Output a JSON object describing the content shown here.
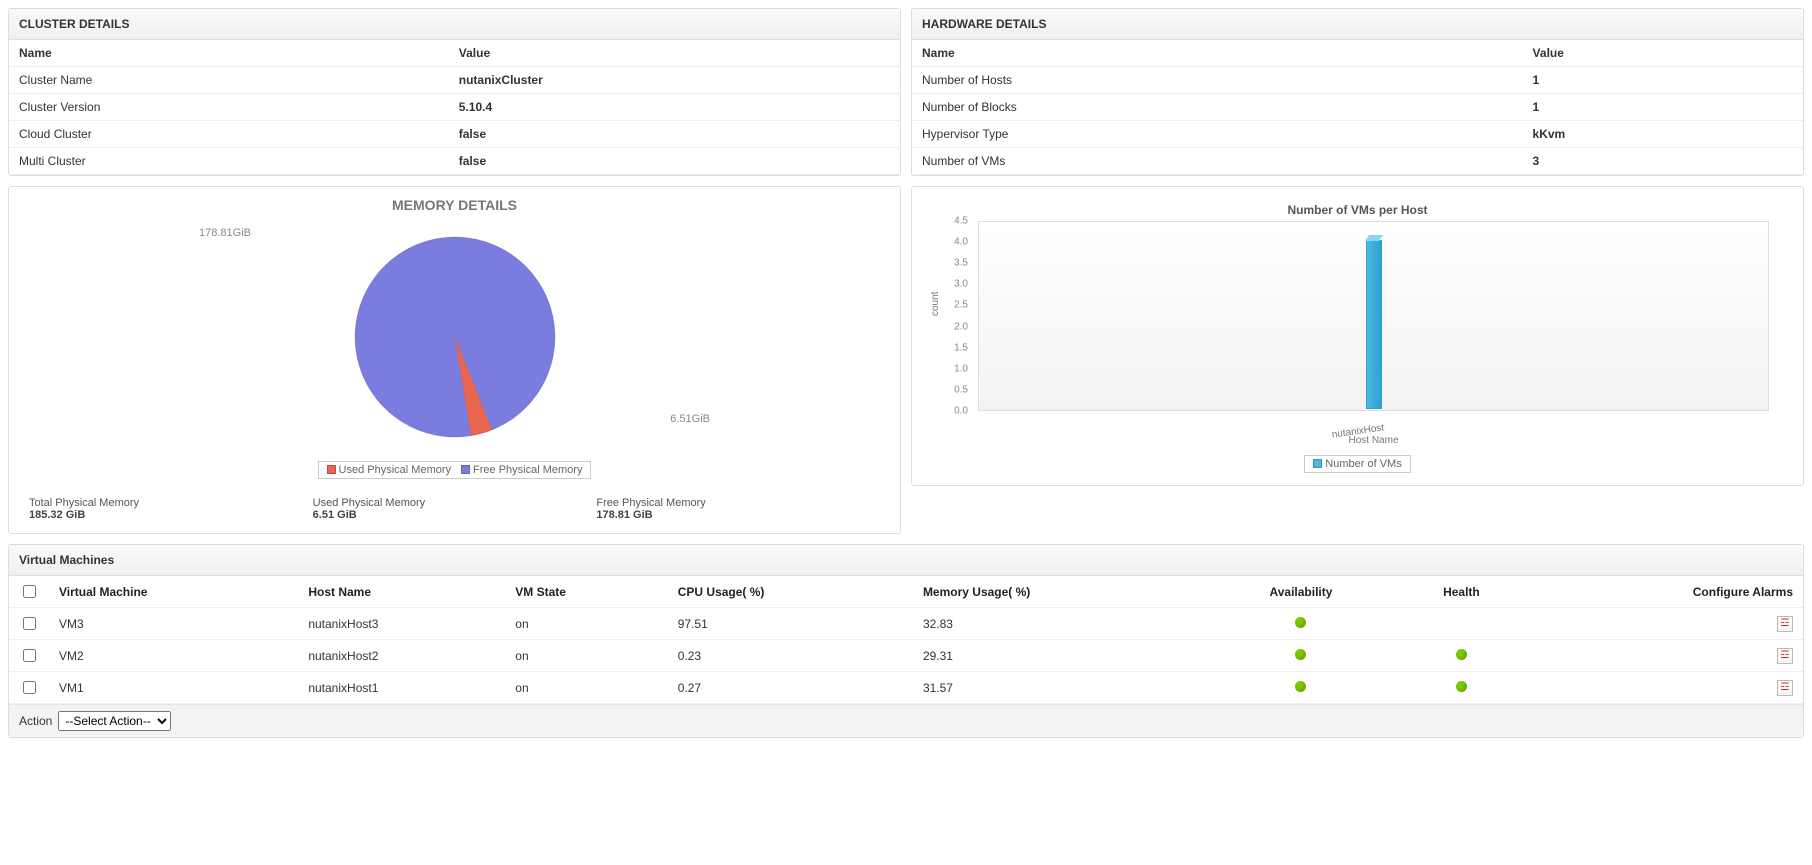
{
  "clusterPanel": {
    "title": "CLUSTER DETAILS",
    "headers": {
      "name": "Name",
      "value": "Value"
    },
    "rows": [
      {
        "name": "Cluster Name",
        "value": "nutanixCluster"
      },
      {
        "name": "Cluster Version",
        "value": "5.10.4"
      },
      {
        "name": "Cloud Cluster",
        "value": "false"
      },
      {
        "name": "Multi Cluster",
        "value": "false"
      }
    ]
  },
  "hardwarePanel": {
    "title": "HARDWARE DETAILS",
    "headers": {
      "name": "Name",
      "value": "Value"
    },
    "rows": [
      {
        "name": "Number of Hosts",
        "value": "1"
      },
      {
        "name": "Number of Blocks",
        "value": "1"
      },
      {
        "name": "Hypervisor Type",
        "value": "kKvm"
      },
      {
        "name": "Number of VMs",
        "value": "3"
      }
    ]
  },
  "memoryPanel": {
    "title": "MEMORY DETAILS",
    "pieLabels": {
      "free": "178.81GiB",
      "used": "6.51GiB"
    },
    "legend": {
      "used": "Used Physical Memory",
      "free": "Free Physical Memory"
    },
    "colors": {
      "used": "#e9654d",
      "free": "#7a7ce0"
    },
    "summary": [
      {
        "label": "Total Physical Memory",
        "value": "185.32 GiB"
      },
      {
        "label": "Used Physical Memory",
        "value": "6.51 GiB"
      },
      {
        "label": "Free Physical Memory",
        "value": "178.81 GiB"
      }
    ]
  },
  "vmsPerHost": {
    "title": "Number of VMs per Host",
    "yLabel": "count",
    "xLabel": "Host Name",
    "legend": "Number of VMs",
    "color": "#4db7e3",
    "ticks": [
      "0.0",
      "0.5",
      "1.0",
      "1.5",
      "2.0",
      "2.5",
      "3.0",
      "3.5",
      "4.0",
      "4.5"
    ],
    "categories": [
      "nutanixHost"
    ],
    "values": [
      4
    ]
  },
  "vmTable": {
    "title": "Virtual Machines",
    "headers": {
      "checkbox": "",
      "vm": "Virtual Machine",
      "host": "Host Name",
      "state": "VM State",
      "cpu": "CPU Usage( %)",
      "mem": "Memory Usage( %)",
      "avail": "Availability",
      "health": "Health",
      "alarms": "Configure Alarms"
    },
    "rows": [
      {
        "vm": "VM3",
        "host": "nutanixHost3",
        "state": "on",
        "cpu": "97.51",
        "mem": "32.83",
        "avail": "green",
        "health": ""
      },
      {
        "vm": "VM2",
        "host": "nutanixHost2",
        "state": "on",
        "cpu": "0.23",
        "mem": "29.31",
        "avail": "green",
        "health": "green"
      },
      {
        "vm": "VM1",
        "host": "nutanixHost1",
        "state": "on",
        "cpu": "0.27",
        "mem": "31.57",
        "avail": "green",
        "health": "green"
      }
    ],
    "actionLabel": "Action",
    "actionSelected": "--Select Action--"
  },
  "chart_data": [
    {
      "type": "pie",
      "title": "MEMORY DETAILS",
      "series": [
        {
          "name": "Used Physical Memory",
          "value": 6.51,
          "unit": "GiB",
          "color": "#e9654d"
        },
        {
          "name": "Free Physical Memory",
          "value": 178.81,
          "unit": "GiB",
          "color": "#7a7ce0"
        }
      ],
      "total": {
        "label": "Total Physical Memory",
        "value": 185.32,
        "unit": "GiB"
      }
    },
    {
      "type": "bar",
      "title": "Number of VMs per Host",
      "xlabel": "Host Name",
      "ylabel": "count",
      "ylim": [
        0,
        4.5
      ],
      "categories": [
        "nutanixHost"
      ],
      "series": [
        {
          "name": "Number of VMs",
          "values": [
            4
          ],
          "color": "#4db7e3"
        }
      ]
    }
  ]
}
